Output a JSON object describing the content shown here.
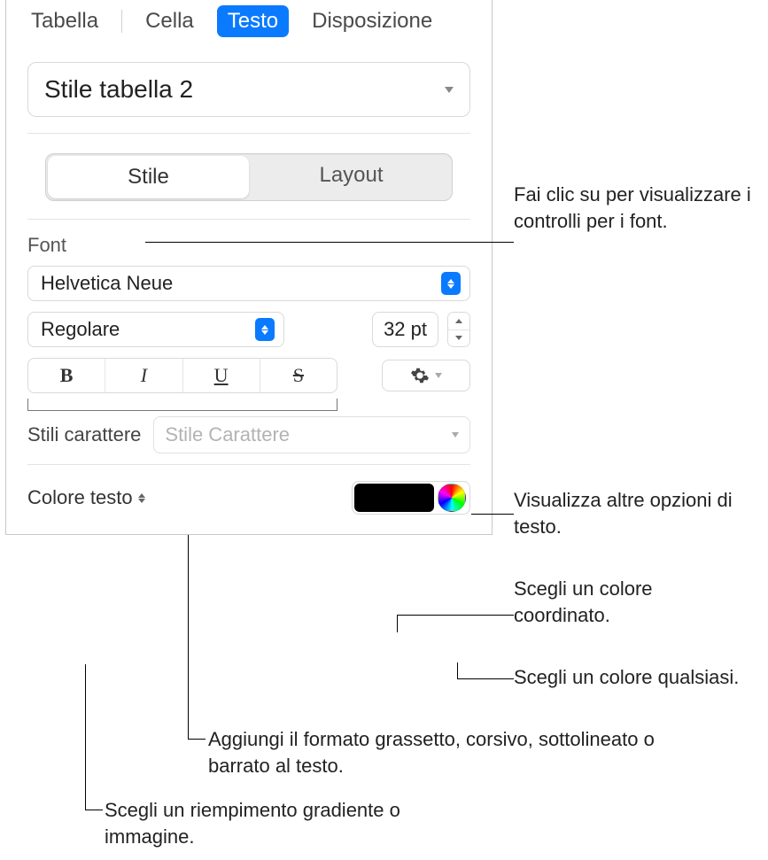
{
  "tabs": {
    "table": "Tabella",
    "cell": "Cella",
    "text": "Testo",
    "arrange": "Disposizione"
  },
  "style_dropdown": {
    "value": "Stile tabella 2"
  },
  "segmented": {
    "style": "Stile",
    "layout": "Layout"
  },
  "font": {
    "section_label": "Font",
    "family": "Helvetica Neue",
    "weight": "Regolare",
    "size": "32 pt",
    "buttons": {
      "bold": "B",
      "italic": "I",
      "underline": "U",
      "strike": "S"
    }
  },
  "char_styles": {
    "label": "Stili carattere",
    "placeholder": "Stile Carattere"
  },
  "text_color": {
    "label": "Colore testo"
  },
  "callouts": {
    "style_tab": "Fai clic su per visualizzare i controlli per i font.",
    "gear": "Visualizza altre opzioni di testo.",
    "swatch": "Scegli un colore coordinato.",
    "wheel": "Scegli un colore qualsiasi.",
    "biu": "Aggiungi il formato grassetto, corsivo, sottolineato o barrato al testo.",
    "textcolor": "Scegli un riempimento gradiente o immagine."
  }
}
